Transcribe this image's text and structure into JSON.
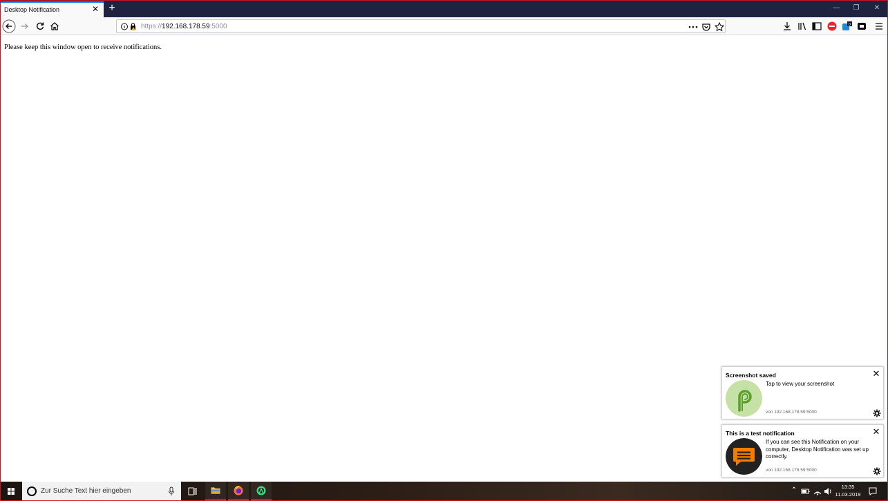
{
  "browser": {
    "tab_title": "Desktop Notification",
    "tab_close": "✕",
    "new_tab": "+",
    "url_scheme": "https://",
    "url_host": "192.168.178.59",
    "url_port": ":5000",
    "window_min": "—",
    "window_restore": "❐",
    "window_close": "✕"
  },
  "page": {
    "message": "Please keep this window open to receive notifications."
  },
  "notifications": [
    {
      "title": "Screenshot saved",
      "body": "Tap to view your screenshot",
      "source": "von 192.168.178.59:5000",
      "icon": "android-p-logo-icon",
      "icon_color": "#c5e1a5",
      "close": "✕"
    },
    {
      "title": "This is a test notification",
      "body": "If you can see this Notification on your computer, Desktop Notification was set up correctly.",
      "source": "von 192.168.178.59:5000",
      "icon": "chat-bubble-icon",
      "icon_color": "#222222",
      "accent": "#f57c00",
      "close": "✕"
    }
  ],
  "taskbar": {
    "search_placeholder": "Zur Suche Text hier eingeben",
    "time": "13:35",
    "date": "11.03.2019"
  }
}
